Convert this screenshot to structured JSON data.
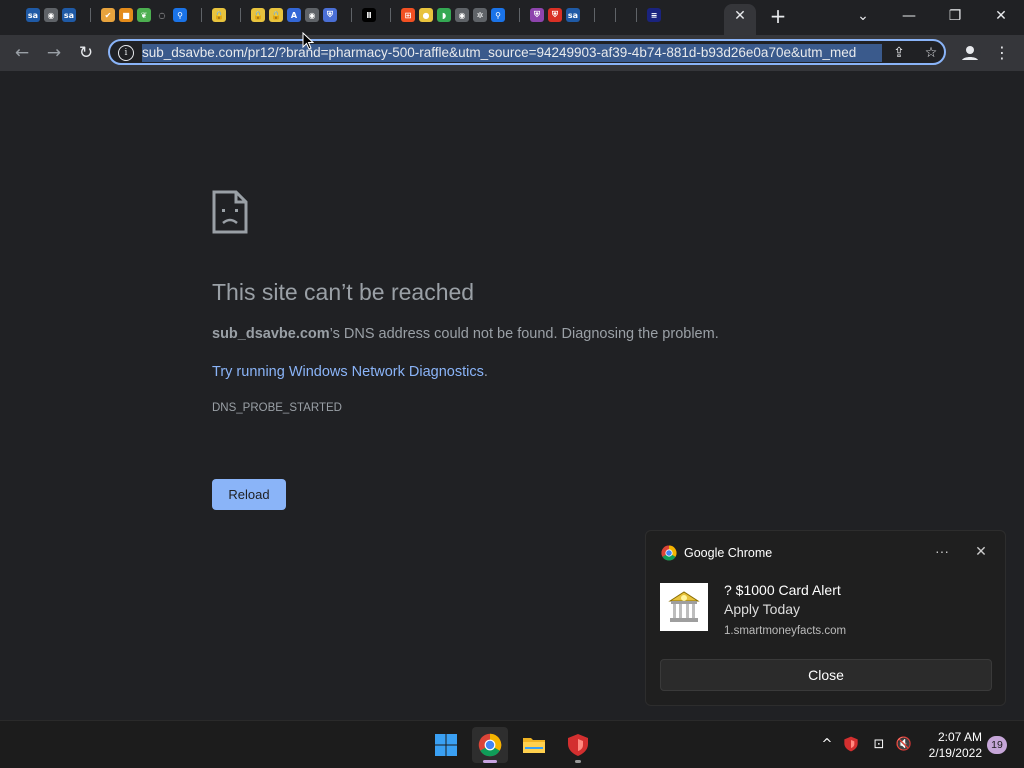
{
  "browser": {
    "tabs": {
      "favicons": [
        {
          "icon": "sa-icon",
          "color": "#1f5aa6",
          "text": "sa"
        },
        {
          "icon": "globe-icon",
          "color": "#5f6368",
          "text": "◉"
        },
        {
          "icon": "sa-icon",
          "color": "#1f5aa6",
          "text": "sa"
        },
        {
          "sep": true
        },
        {
          "icon": "check-icon",
          "color": "#e8a33d",
          "text": "✔"
        },
        {
          "icon": "orange-app-icon",
          "color": "#e48b1a",
          "text": "■"
        },
        {
          "icon": "leaf-icon",
          "color": "#4caf50",
          "text": "❦"
        },
        {
          "icon": "loading-icon",
          "color": "#202124",
          "text": "◌"
        },
        {
          "icon": "pin-icon",
          "color": "#1a73e8",
          "text": "⚲"
        },
        {
          "sep": true
        },
        {
          "icon": "lock-icon",
          "color": "#e8c33d",
          "text": "🔒"
        },
        {
          "sep": true
        },
        {
          "icon": "lock-icon",
          "color": "#e8c33d",
          "text": "🔒"
        },
        {
          "icon": "lock-icon",
          "color": "#e8c33d",
          "text": "🔒"
        },
        {
          "icon": "a-app-icon",
          "color": "#3367d6",
          "text": "A"
        },
        {
          "icon": "globe-icon",
          "color": "#5f6368",
          "text": "◉"
        },
        {
          "icon": "shield-icon",
          "color": "#4a6fd6",
          "text": "⛨"
        },
        {
          "sep": true
        },
        {
          "icon": "medium-icon",
          "color": "#000000",
          "text": "Ⅱ"
        },
        {
          "sep": true
        },
        {
          "icon": "windows-icon",
          "color": "#f25022",
          "text": "⊞"
        },
        {
          "icon": "yellow-app-icon",
          "color": "#e8c33d",
          "text": "●"
        },
        {
          "icon": "green-app-icon",
          "color": "#34a853",
          "text": "◗"
        },
        {
          "icon": "globe-icon",
          "color": "#5f6368",
          "text": "◉"
        },
        {
          "icon": "gear-app-icon",
          "color": "#5f6368",
          "text": "✲"
        },
        {
          "icon": "pin-icon",
          "color": "#1a73e8",
          "text": "⚲"
        },
        {
          "sep": true
        },
        {
          "icon": "purple-shield-icon",
          "color": "#8e44ad",
          "text": "⛨"
        },
        {
          "icon": "red-shield-icon",
          "color": "#d93025",
          "text": "⛨"
        },
        {
          "icon": "sa-icon",
          "color": "#1f5aa6",
          "text": "sa"
        },
        {
          "sep": true
        },
        {
          "sep": true
        },
        {
          "sep": true
        },
        {
          "icon": "blue-app-icon",
          "color": "#1a237e",
          "text": "≡"
        }
      ],
      "close_label": "✕",
      "new_tab_label": "+"
    },
    "window_controls": {
      "dropdown": "⌄",
      "minimize": "—",
      "restore": "❐",
      "close": "✕"
    },
    "toolbar": {
      "back": "←",
      "forward": "→",
      "reload": "↻",
      "url": "sub_dsavbe.com/pr12/?brand=pharmacy-500-raffle&utm_source=94249903-af39-4b74-881d-b93d26e0a70e&utm_med",
      "share": "⇪",
      "star": "☆",
      "menu": "⋮"
    }
  },
  "error_page": {
    "title": "This site can’t be reached",
    "domain": "sub_dsavbe.com",
    "description": "’s DNS address could not be found. Diagnosing the problem.",
    "diagnostics_link": "Try running Windows Network Diagnostics",
    "diagnostics_suffix": ".",
    "error_code": "DNS_PROBE_STARTED",
    "reload_label": "Reload"
  },
  "notification": {
    "app_name": "Google Chrome",
    "more_label": "···",
    "dismiss_label": "✕",
    "title": "? $1000 Card Alert",
    "body": "Apply Today",
    "source": "1.smartmoneyfacts.com",
    "close_label": "Close"
  },
  "taskbar": {
    "tray": {
      "chevron": "^",
      "wifi": "⊡",
      "volume": "🔇"
    },
    "time": "2:07 AM",
    "date": "2/19/2022",
    "notification_count": "19"
  }
}
